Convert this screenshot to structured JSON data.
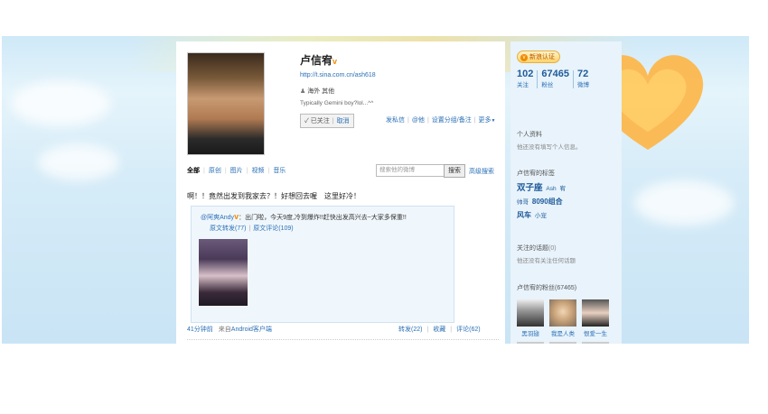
{
  "profile": {
    "name": "卢信宥",
    "verified_mark": "v",
    "url": "http://t.sina.com.cn/ash618",
    "location": "海外 其他",
    "bio": "Typically Gemini boy?lol...^^",
    "followed_label": "已关注",
    "cancel_label": "取消"
  },
  "profile_actions": {
    "send_message": "发私信",
    "mention": "@他",
    "set_group": "设置分组/备注",
    "more": "更多"
  },
  "feed_tabs": [
    "全部",
    "原创",
    "图片",
    "视频",
    "音乐"
  ],
  "search": {
    "placeholder": "搜索他的微博",
    "button": "搜索",
    "advanced": "高级搜索"
  },
  "post": {
    "text": "啊！！竟然出发到我家去？！好想回去喔　这里好冷！",
    "repost": {
      "user": "@阿爽Andy",
      "user_mark": "v",
      "text": "：出门啦，今天9度,冷到爆炸!!赶快出发高兴去~大家多保重!!",
      "forward_count": "原文转发(77)",
      "comment_count": "原文评论(109)"
    },
    "time": "41分钟前",
    "from_label": "来自",
    "source": "Android客户端",
    "forward": "转发(22)",
    "favorite": "收藏",
    "comment": "评论(62)"
  },
  "sidebar": {
    "verify_banner": "新浪认证",
    "stats": [
      {
        "num": "102",
        "label": "关注"
      },
      {
        "num": "67465",
        "label": "粉丝"
      },
      {
        "num": "72",
        "label": "微博"
      }
    ],
    "personal_title": "个人资料",
    "personal_sub": "他还没有填写个人信息。",
    "tags_title": "卢信宥的标签",
    "tags": [
      {
        "text": "双子座",
        "size": "l"
      },
      {
        "text": "Ash",
        "size": "s"
      },
      {
        "text": "宥",
        "size": "s"
      },
      {
        "text": "帅哥",
        "size": "s"
      },
      {
        "text": "8090组合",
        "size": "m"
      },
      {
        "text": "风车",
        "size": "m"
      },
      {
        "text": "小宠",
        "size": "s"
      }
    ],
    "topics_title": "关注的话题",
    "topics_count": "(0)",
    "topics_sub": "他还没有关注任何话题",
    "fans_title": "卢信宥的粉丝(67465)",
    "fans": [
      {
        "name": "黑羽翅"
      },
      {
        "name": "我是人类"
      },
      {
        "name": "恨爱一生"
      }
    ]
  },
  "colors": {
    "link": "#2a6fb5",
    "verify_orange": "#f08a00",
    "sky": "#cfe9f8"
  }
}
